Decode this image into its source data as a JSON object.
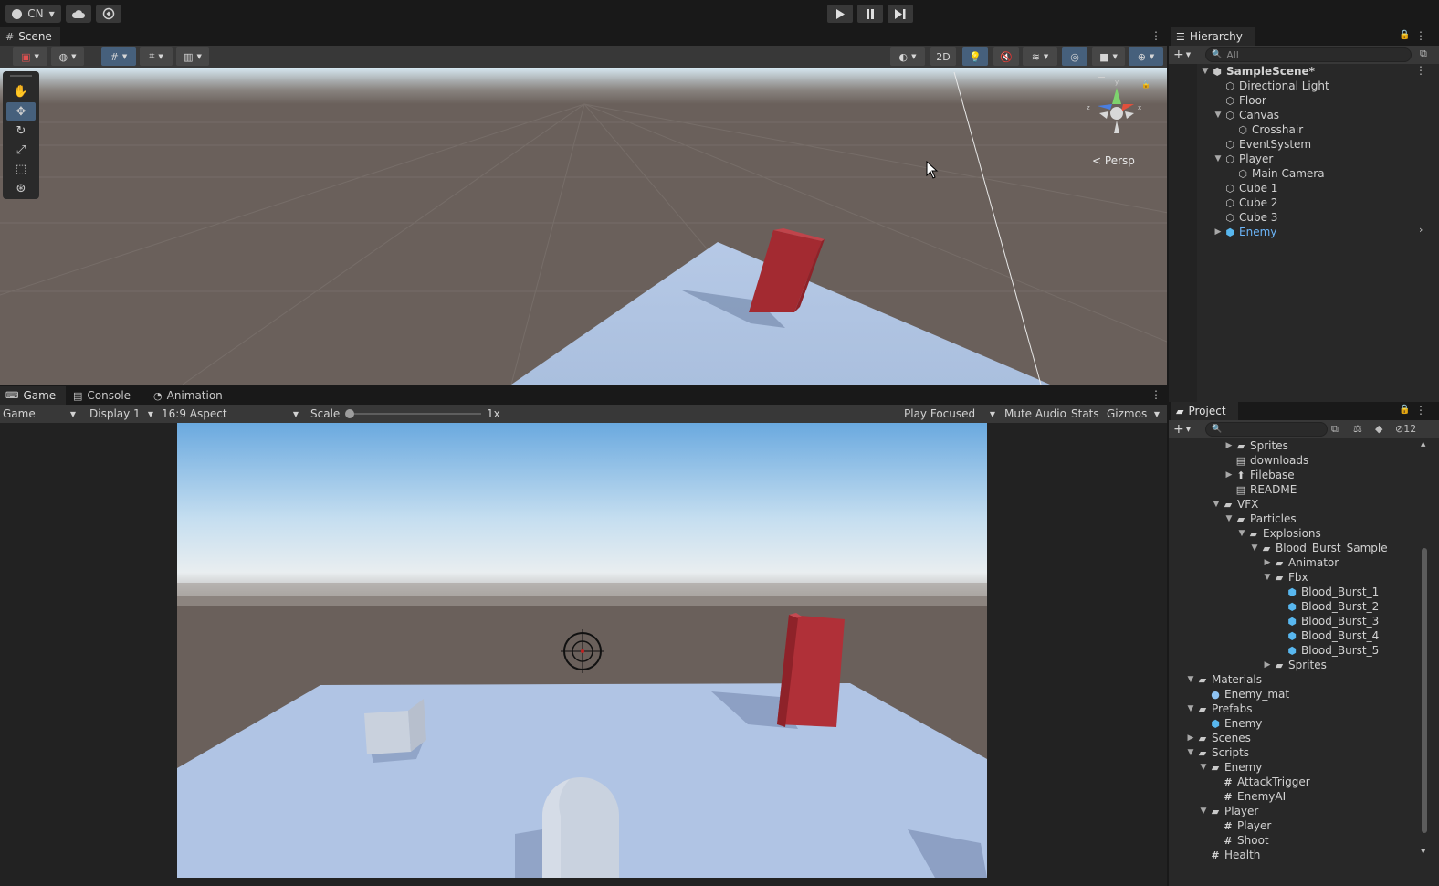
{
  "topbar": {
    "account": "CN",
    "account_icon": "account-icon",
    "cloud_icon": "cloud-icon",
    "collab_icon": "collab-icon",
    "play_icon": "play-icon",
    "pause_icon": "pause-icon",
    "step_icon": "step-icon"
  },
  "scene": {
    "tab_label": "Scene",
    "persp_label": "Persp",
    "toggle_2d": "2D",
    "colors": {
      "sky_top": "#b6d4e8",
      "ground": "#6a605b",
      "floor": "#b1c6e4",
      "cube": "#a32a31"
    }
  },
  "game": {
    "tabs": [
      "Game",
      "Console",
      "Animation"
    ],
    "toolbar": {
      "mode": "Game",
      "display": "Display 1",
      "aspect": "16:9 Aspect",
      "scale_label": "Scale",
      "scale_value": "1x",
      "play_focused": "Play Focused",
      "mute_audio": "Mute Audio",
      "stats": "Stats",
      "gizmos": "Gizmos"
    }
  },
  "hierarchy": {
    "tab_label": "Hierarchy",
    "search_placeholder": "All",
    "items": [
      {
        "label": "SampleScene*",
        "depth": 0,
        "arrow": "▼",
        "icon": "unity-scene-icon",
        "bold": true
      },
      {
        "label": "Directional Light",
        "depth": 1,
        "arrow": "",
        "icon": "gameobject-icon"
      },
      {
        "label": "Floor",
        "depth": 1,
        "arrow": "",
        "icon": "gameobject-icon"
      },
      {
        "label": "Canvas",
        "depth": 1,
        "arrow": "▼",
        "icon": "gameobject-icon"
      },
      {
        "label": "Crosshair",
        "depth": 2,
        "arrow": "",
        "icon": "gameobject-icon"
      },
      {
        "label": "EventSystem",
        "depth": 1,
        "arrow": "",
        "icon": "gameobject-icon"
      },
      {
        "label": "Player",
        "depth": 1,
        "arrow": "▼",
        "icon": "gameobject-icon"
      },
      {
        "label": "Main Camera",
        "depth": 2,
        "arrow": "",
        "icon": "gameobject-icon"
      },
      {
        "label": "Cube 1",
        "depth": 1,
        "arrow": "",
        "icon": "gameobject-icon"
      },
      {
        "label": "Cube 2",
        "depth": 1,
        "arrow": "",
        "icon": "gameobject-icon"
      },
      {
        "label": "Cube 3",
        "depth": 1,
        "arrow": "",
        "icon": "gameobject-icon"
      },
      {
        "label": "Enemy",
        "depth": 1,
        "arrow": "▶",
        "icon": "prefab-icon",
        "prefab": true
      }
    ]
  },
  "project": {
    "tab_label": "Project",
    "hidden_count": "12",
    "items": [
      {
        "label": "Sprites",
        "depth": 4,
        "arrow": "▶",
        "type": "folder"
      },
      {
        "label": "downloads",
        "depth": 4,
        "arrow": "",
        "type": "doc"
      },
      {
        "label": "Filebase",
        "depth": 4,
        "arrow": "▶",
        "type": "file"
      },
      {
        "label": "README",
        "depth": 4,
        "arrow": "",
        "type": "doc"
      },
      {
        "label": "VFX",
        "depth": 3,
        "arrow": "▼",
        "type": "folder"
      },
      {
        "label": "Particles",
        "depth": 4,
        "arrow": "▼",
        "type": "folder"
      },
      {
        "label": "Explosions",
        "depth": 5,
        "arrow": "▼",
        "type": "folder"
      },
      {
        "label": "Blood_Burst_Sample",
        "depth": 6,
        "arrow": "▼",
        "type": "folder"
      },
      {
        "label": "Animator",
        "depth": 7,
        "arrow": "▶",
        "type": "folder"
      },
      {
        "label": "Fbx",
        "depth": 7,
        "arrow": "▼",
        "type": "folder"
      },
      {
        "label": "Blood_Burst_1",
        "depth": 8,
        "arrow": "",
        "type": "prefab"
      },
      {
        "label": "Blood_Burst_2",
        "depth": 8,
        "arrow": "",
        "type": "prefab"
      },
      {
        "label": "Blood_Burst_3",
        "depth": 8,
        "arrow": "",
        "type": "prefab"
      },
      {
        "label": "Blood_Burst_4",
        "depth": 8,
        "arrow": "",
        "type": "prefab"
      },
      {
        "label": "Blood_Burst_5",
        "depth": 8,
        "arrow": "",
        "type": "prefab"
      },
      {
        "label": "Sprites",
        "depth": 7,
        "arrow": "▶",
        "type": "folder"
      },
      {
        "label": "Materials",
        "depth": 1,
        "arrow": "▼",
        "type": "folder"
      },
      {
        "label": "Enemy_mat",
        "depth": 2,
        "arrow": "",
        "type": "material"
      },
      {
        "label": "Prefabs",
        "depth": 1,
        "arrow": "▼",
        "type": "folder"
      },
      {
        "label": "Enemy",
        "depth": 2,
        "arrow": "",
        "type": "prefab"
      },
      {
        "label": "Scenes",
        "depth": 1,
        "arrow": "▶",
        "type": "folder"
      },
      {
        "label": "Scripts",
        "depth": 1,
        "arrow": "▼",
        "type": "folder"
      },
      {
        "label": "Enemy",
        "depth": 2,
        "arrow": "▼",
        "type": "folder"
      },
      {
        "label": "AttackTrigger",
        "depth": 3,
        "arrow": "",
        "type": "script"
      },
      {
        "label": "EnemyAI",
        "depth": 3,
        "arrow": "",
        "type": "script"
      },
      {
        "label": "Player",
        "depth": 2,
        "arrow": "▼",
        "type": "folder"
      },
      {
        "label": "Player",
        "depth": 3,
        "arrow": "",
        "type": "script"
      },
      {
        "label": "Shoot",
        "depth": 3,
        "arrow": "",
        "type": "script"
      },
      {
        "label": "Health",
        "depth": 2,
        "arrow": "",
        "type": "script"
      }
    ]
  }
}
